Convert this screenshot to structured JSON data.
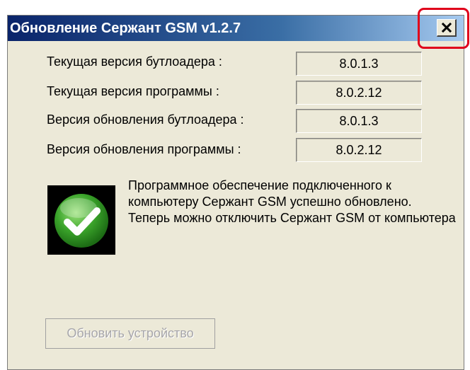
{
  "window": {
    "title": "Обновление Сержант GSM v1.2.7",
    "close_icon": "close-icon"
  },
  "versions": [
    {
      "label": "Текущая версия  бутлоадера :",
      "value": "8.0.1.3"
    },
    {
      "label": "Текущая версия  программы :",
      "value": "8.0.2.12"
    },
    {
      "label": "Версия обновления бутлоадера :",
      "value": "8.0.1.3"
    },
    {
      "label": "Версия обновления программы :",
      "value": "8.0.2.12"
    }
  ],
  "status": {
    "icon": "checkmark-icon",
    "icon_color": "#3aa32a",
    "message_line1": "Программное обеспечение подключенного к компьютеру Сержант GSM успешно обновлено.",
    "message_line2": "Теперь можно отключить Сержант GSM от компьютера"
  },
  "update_button_label": "Обновить устройство",
  "highlight_color": "#e0001b"
}
